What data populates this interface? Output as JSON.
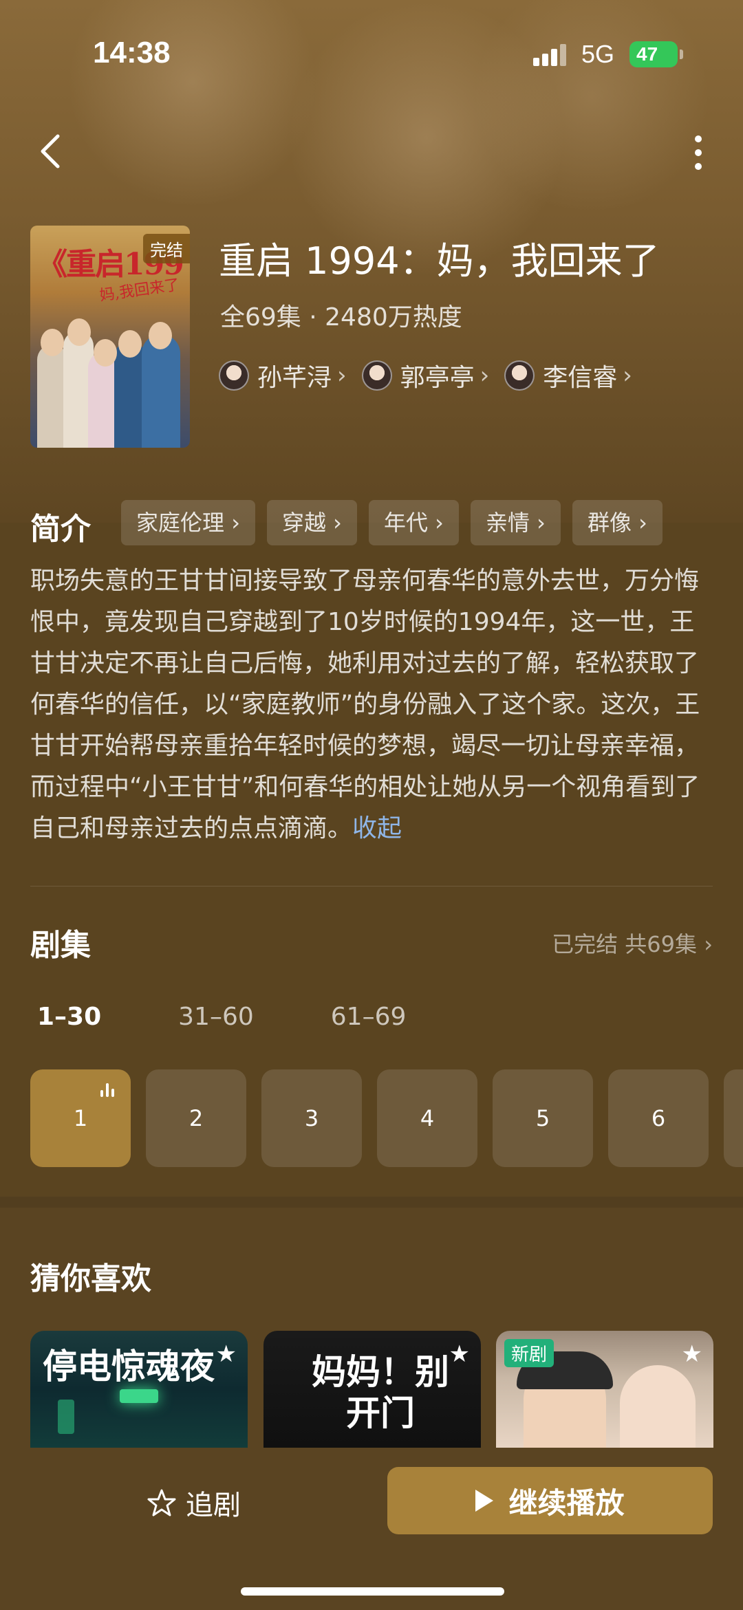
{
  "status_bar": {
    "time": "14:38",
    "network": "5G",
    "battery": "47"
  },
  "nav": {
    "back_icon": "chevron-left-icon",
    "more_icon": "more-vertical-icon"
  },
  "show": {
    "poster_title": "《重启199",
    "poster_subtitle": "妈,我回来了",
    "poster_badge": "完结",
    "title": "重启 1994：妈，我回来了",
    "meta": "全69集 · 2480万热度",
    "cast": [
      {
        "name": "孙芊浔"
      },
      {
        "name": "郭亭亭"
      },
      {
        "name": "李信睿"
      }
    ]
  },
  "intro": {
    "label": "简介",
    "tags": [
      "家庭伦理",
      "穿越",
      "年代",
      "亲情",
      "群像"
    ],
    "synopsis": "职场失意的王甘甘间接导致了母亲何春华的意外去世，万分悔恨中，竟发现自己穿越到了10岁时候的1994年，这一世，王甘甘决定不再让自己后悔，她利用对过去的了解，轻松获取了何春华的信任，以“家庭教师”的身份融入了这个家。这次，王甘甘开始帮母亲重拾年轻时候的梦想，竭尽一切让母亲幸福，而过程中“小王甘甘”和何春华的相处让她从另一个视角看到了自己和母亲过去的点点滴滴。",
    "collapse_label": "收起"
  },
  "episodes": {
    "title": "剧集",
    "status": "已完结 共69集",
    "ranges": [
      "1–30",
      "31–60",
      "61–69"
    ],
    "active_range": 0,
    "visible": [
      "1",
      "2",
      "3",
      "4",
      "5",
      "6"
    ],
    "playing": "1"
  },
  "recommend": {
    "title": "猜你喜欢",
    "items": [
      {
        "title": "停电惊魂夜",
        "badge": ""
      },
      {
        "title": "妈妈！别开门",
        "badge": ""
      },
      {
        "title": "",
        "badge": "新剧"
      }
    ]
  },
  "bottom": {
    "follow_label": "追剧",
    "play_label": "继续播放"
  },
  "colors": {
    "accent": "#a8823a",
    "background": "#5a4420",
    "link": "#8fb6e8",
    "battery": "#34c759"
  }
}
